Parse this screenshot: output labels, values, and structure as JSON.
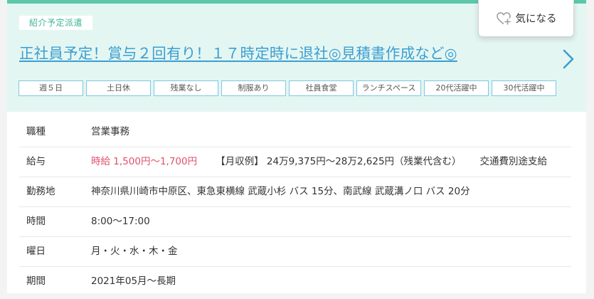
{
  "job": {
    "category_badge": "紹介予定派遣",
    "title": "正社員予定！賞与２回有り！１７時定時に退社◎見積書作成など◎",
    "tags": [
      "週５日",
      "土日休",
      "残業なし",
      "制服あり",
      "社員食堂",
      "ランチスペース",
      "20代活躍中",
      "30代活躍中"
    ]
  },
  "details": {
    "job_type": {
      "label": "職種",
      "value": "営業事務"
    },
    "salary": {
      "label": "給与",
      "hourly": "時給 1,500円〜1,700円",
      "monthly_example": "【月収例】 24万9,375円〜28万2,625円（残業代含む）",
      "transport": "交通費別途支給"
    },
    "location": {
      "label": "勤務地",
      "value": "神奈川県川崎市中原区、東急東横線 武蔵小杉 バス 15分、南武線 武蔵溝ノ口 バス 20分"
    },
    "hours": {
      "label": "時間",
      "value": "8:00〜17:00"
    },
    "days": {
      "label": "曜日",
      "value": "月・火・水・木・金"
    },
    "period": {
      "label": "期間",
      "value": "2021年05月〜長期"
    }
  },
  "favorite": {
    "label": "気になる",
    "icon": "heart-plus-icon"
  },
  "icons": {
    "next": "chevron-right-icon"
  },
  "colors": {
    "accent_green": "#5bc8aa",
    "header_bg": "#e4f6f1",
    "link_blue": "#3a9ed3",
    "tag_border": "#7ec8e3",
    "wage_red": "#e0506a"
  }
}
